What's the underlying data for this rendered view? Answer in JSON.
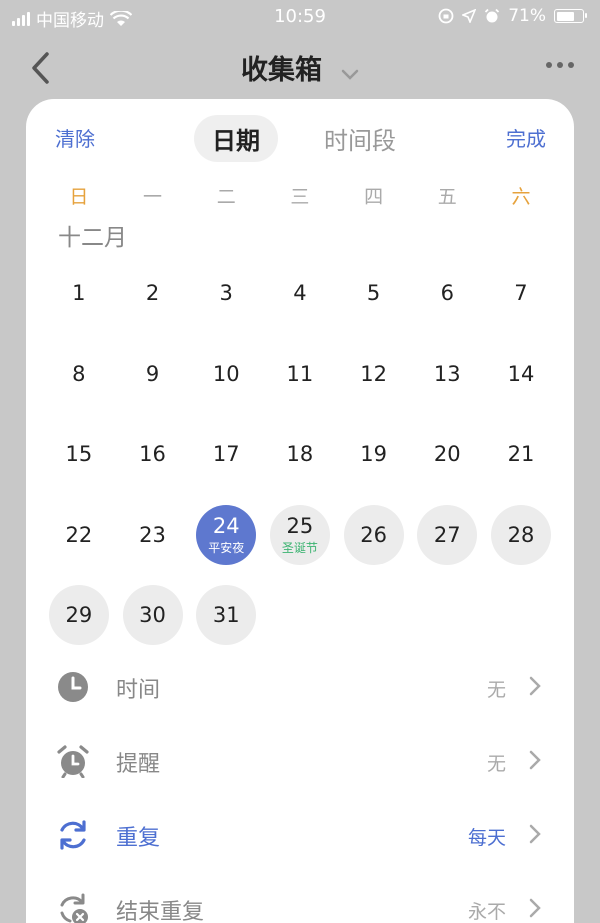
{
  "status_bar": {
    "carrier": "中国移动",
    "time": "10:59",
    "battery": "71%",
    "battery_level": 0.71
  },
  "nav": {
    "title": "收集箱"
  },
  "sheet": {
    "clear_label": "清除",
    "done_label": "完成",
    "tabs": [
      {
        "label": "日期",
        "active": true
      },
      {
        "label": "时间段",
        "active": false
      }
    ],
    "weekdays": [
      "日",
      "一",
      "二",
      "三",
      "四",
      "五",
      "六"
    ],
    "month_label": "十二月",
    "weeks": [
      [
        {
          "d": "1"
        },
        {
          "d": "2"
        },
        {
          "d": "3"
        },
        {
          "d": "4"
        },
        {
          "d": "5"
        },
        {
          "d": "6"
        },
        {
          "d": "7"
        }
      ],
      [
        {
          "d": "8"
        },
        {
          "d": "9"
        },
        {
          "d": "10"
        },
        {
          "d": "11"
        },
        {
          "d": "12"
        },
        {
          "d": "13"
        },
        {
          "d": "14"
        }
      ],
      [
        {
          "d": "15"
        },
        {
          "d": "16"
        },
        {
          "d": "17"
        },
        {
          "d": "18"
        },
        {
          "d": "19"
        },
        {
          "d": "20"
        },
        {
          "d": "21"
        }
      ],
      [
        {
          "d": "22"
        },
        {
          "d": "23"
        },
        {
          "d": "24",
          "sub": "平安夜",
          "state": "selected"
        },
        {
          "d": "25",
          "sub": "圣诞节",
          "state": "festival"
        },
        {
          "d": "26",
          "state": "future"
        },
        {
          "d": "27",
          "state": "future"
        },
        {
          "d": "28",
          "state": "future"
        }
      ],
      [
        {
          "d": "29",
          "state": "future"
        },
        {
          "d": "30",
          "state": "future"
        },
        {
          "d": "31",
          "state": "future"
        }
      ]
    ]
  },
  "options": [
    {
      "label": "时间",
      "value": "无",
      "icon": "clock-icon",
      "active": false
    },
    {
      "label": "提醒",
      "value": "无",
      "icon": "alarm-icon",
      "active": false
    },
    {
      "label": "重复",
      "value": "每天",
      "icon": "repeat-icon",
      "active": true
    },
    {
      "label": "结束重复",
      "value": "永不",
      "icon": "end-repeat-icon",
      "active": false
    }
  ],
  "colors": {
    "accent": "#4d6fd1",
    "selected_day": "#5e78cf",
    "weekend": "#e6a23c",
    "festival": "#3cb371"
  }
}
